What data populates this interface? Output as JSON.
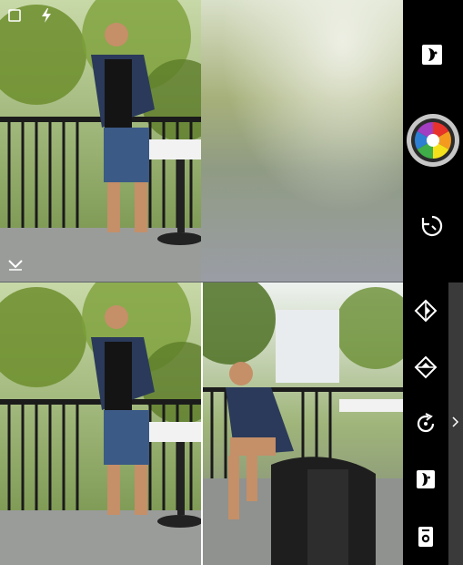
{
  "app": "camera-collage",
  "icons": {
    "top_left_1": "square-frame-icon",
    "top_left_2": "flash-icon",
    "collapse": "chevron-down-icon",
    "filter_face": "face-filter-icon",
    "color_wheel": "color-wheel-icon",
    "rotate": "rotate-icon",
    "flip_h": "flip-horizontal-icon",
    "flip_v": "flip-vertical-icon",
    "rotate_cw": "rotate-clockwise-icon",
    "face_filter_2": "face-filter-icon",
    "switch_camera": "switch-camera-icon",
    "expand": "chevron-right-icon"
  },
  "colors": {
    "bar": "#000000",
    "edge_strip": "#3a3a3a",
    "divider": "#ffffff"
  }
}
